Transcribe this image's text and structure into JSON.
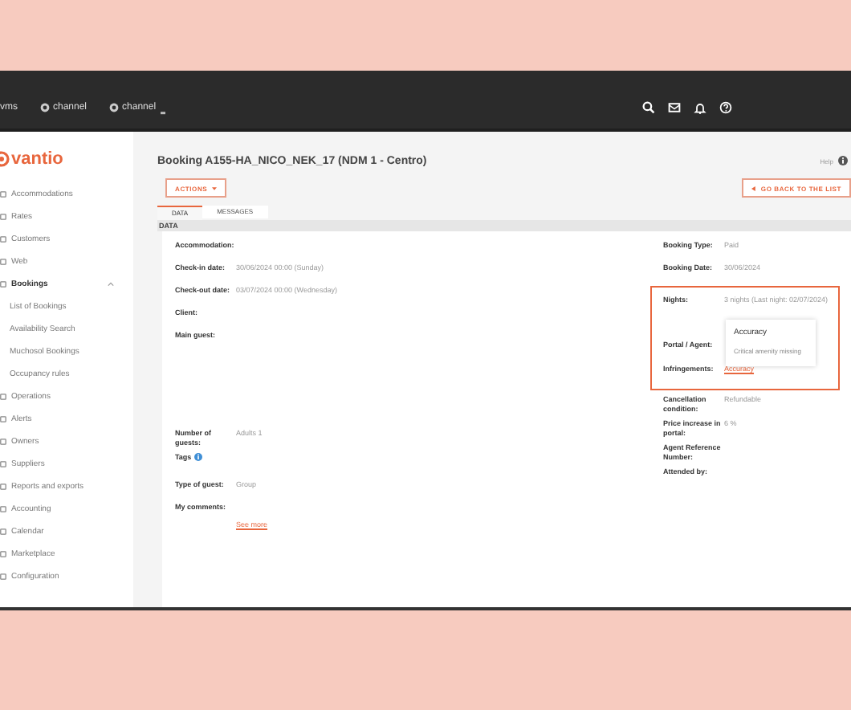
{
  "topbar": {
    "products": [
      {
        "label": "vms",
        "kind": "plain"
      },
      {
        "label": "channel",
        "kind": "logo"
      },
      {
        "label": "channel",
        "kind": "logo-pro"
      }
    ]
  },
  "sidebar": {
    "brand": "vantio",
    "items": [
      {
        "label": "Accommodations"
      },
      {
        "label": "Rates"
      },
      {
        "label": "Customers"
      },
      {
        "label": "Web"
      },
      {
        "label": "Bookings",
        "expanded": true,
        "children": [
          {
            "label": "List of Bookings"
          },
          {
            "label": "Availability Search"
          },
          {
            "label": "Muchosol Bookings"
          },
          {
            "label": "Occupancy rules"
          }
        ]
      },
      {
        "label": "Operations"
      },
      {
        "label": "Alerts"
      },
      {
        "label": "Owners"
      },
      {
        "label": "Suppliers"
      },
      {
        "label": "Reports and exports"
      },
      {
        "label": "Accounting"
      },
      {
        "label": "Calendar"
      },
      {
        "label": "Marketplace"
      },
      {
        "label": "Configuration"
      }
    ]
  },
  "page": {
    "title": "Booking A155-HA_NICO_NEK_17 (NDM 1 - Centro)",
    "help": "Help",
    "actions": "ACTIONS",
    "back": "GO BACK TO THE LIST"
  },
  "tabs": [
    {
      "label": "DATA",
      "selected": true
    },
    {
      "label": "MESSAGES",
      "selected": false
    }
  ],
  "section": "DATA",
  "left_fields": [
    {
      "label": "Accommodation:"
    },
    {
      "label": "Check-in date:",
      "value": "30/06/2024 00:00 (Sunday)"
    },
    {
      "label": "Check-out date:",
      "value": "03/07/2024 00:00 (Wednesday)"
    },
    {
      "label": "Client:"
    },
    {
      "label": "Main guest:"
    },
    {
      "label": "Number of guests:",
      "value": "Adults 1"
    },
    {
      "label": "Tags",
      "info": true
    },
    {
      "label": "Type of guest:",
      "value": "Group"
    },
    {
      "label": "My comments:",
      "link": "See more"
    }
  ],
  "right_fields": [
    {
      "label": "Booking Type:",
      "value": "Paid",
      "highlighted": false
    },
    {
      "label": "Booking Date:",
      "value": "30/06/2024",
      "highlighted": false
    },
    {
      "label": "Nights:",
      "value": "3 nights (Last night: 02/07/2024)",
      "highlighted": true
    },
    {
      "label": "Portal / Agent:",
      "highlighted": true
    },
    {
      "label": "Infringements:",
      "link": "Accuracy",
      "highlighted": true,
      "tooltip": {
        "title": "Accuracy",
        "text": "Critical amenity missing"
      }
    },
    {
      "label": "Cancellation condition:",
      "value": "Refundable",
      "highlighted": false
    },
    {
      "label": "Price increase in portal:",
      "value": "6 %",
      "highlighted": false
    },
    {
      "label": "Agent Reference Number:",
      "highlighted": false
    },
    {
      "label": "Attended by:",
      "highlighted": false
    }
  ]
}
